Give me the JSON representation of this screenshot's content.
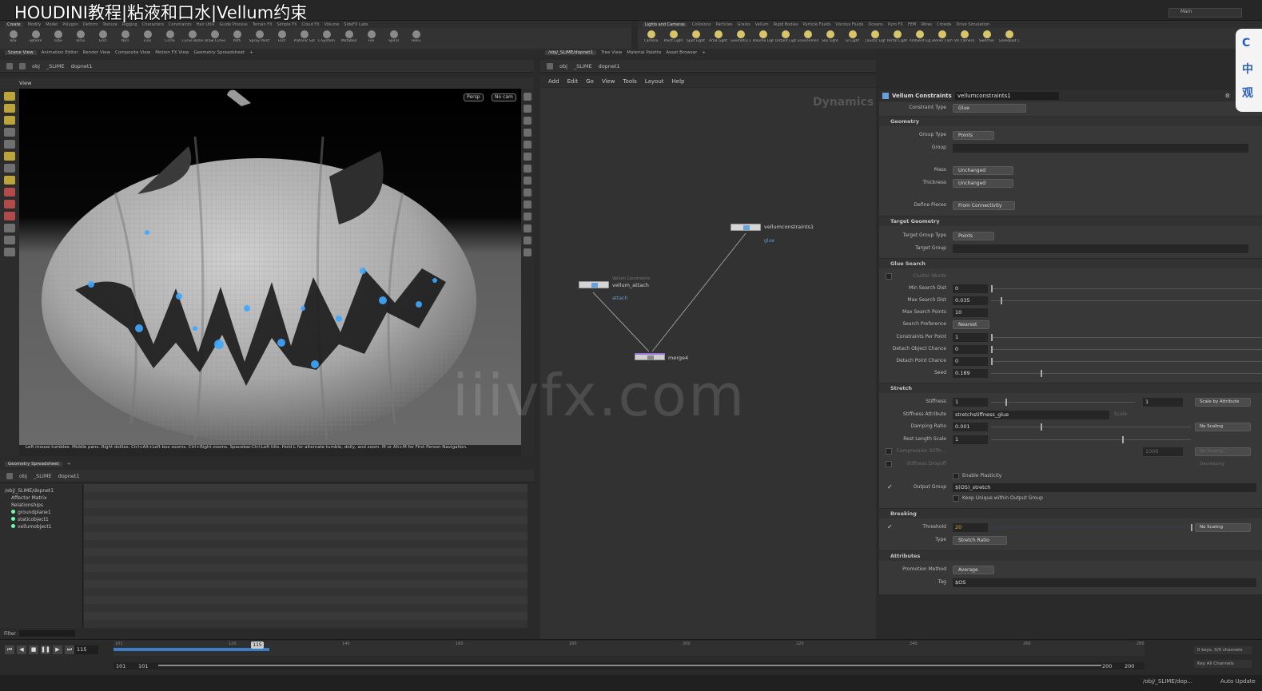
{
  "video_title": "HOUDINI教程|粘液和口水|Vellum约束",
  "watermark": "iiivfx.com",
  "corner_logo": [
    "C",
    "中",
    "观"
  ],
  "desktop": {
    "label": "Main"
  },
  "shelf_tabs_left": [
    "Create",
    "Modify",
    "Model",
    "Polygon",
    "Deform",
    "Texture",
    "Rigging",
    "Characters",
    "Constraints",
    "Hair Utils",
    "Guide Process",
    "Terrain FX",
    "Simple FX",
    "Cloud FX",
    "Volume",
    "SideFX Labs"
  ],
  "shelf_tabs_right": [
    "Lights and Cameras",
    "Collisions",
    "Particles",
    "Grains",
    "Vellum",
    "Rigid Bodies",
    "Particle Fluids",
    "Viscous Fluids",
    "Oceans",
    "Pyro FX",
    "FEM",
    "Wires",
    "Crowds",
    "Drive Simulation"
  ],
  "shelf_tools_left": [
    "Box",
    "Sphere",
    "Tube",
    "Torus",
    "Grid",
    "Null",
    "Line",
    "Circle",
    "Curve Bezier",
    "Draw Curve",
    "Path",
    "Spray Paint",
    "Font",
    "Platonic Solids",
    "L-System",
    "Metaball",
    "File",
    "Spiral",
    "Helix"
  ],
  "shelf_tools_right": [
    "Camera",
    "Point Light",
    "Spot Light",
    "Area Light",
    "Geometry Light",
    "Volume Light",
    "Distant Light",
    "Environment Light",
    "Sky Light",
    "GI Light",
    "Caustic Light",
    "Portal Light",
    "Ambient Light",
    "Stereo Camera",
    "VR Camera",
    "Switcher",
    "Gamepad Camera"
  ],
  "left_pane_tabs": [
    "Scene View",
    "Animation Editor",
    "Render View",
    "Composite View",
    "Motion FX View",
    "Geometry Spreadsheet"
  ],
  "right_pane_tabs": [
    "/obj/_SLIME/dopnet1",
    "Tree View",
    "Material Palette",
    "Asset Browser"
  ],
  "path": {
    "root": "obj",
    "object": "_SLIME",
    "node": "dopnet1"
  },
  "viewport": {
    "label": "View",
    "perspective": "Persp",
    "camera": "No cam",
    "hint": "Left mouse tumbles. Middle pans. Right dollies. Ctrl+Alt+Left box zooms. Ctrl+Right zooms. Spacebar-Ctrl-Left tilts. Hold L for alternate tumble, dolly, and zoom.    M or Alt+M for First Person Navigation."
  },
  "spreadsheet": {
    "tab": "Geometry Spreadsheet",
    "path_node": "dopnet1",
    "tree": [
      "/obj/_SLIME/dopnet1",
      "Affector Matrix",
      "Relationships",
      "groundplane1",
      "staticobject1",
      "vellumobject1"
    ],
    "filter_label": "Filter"
  },
  "network": {
    "menu": [
      "Add",
      "Edit",
      "Go",
      "View",
      "Tools",
      "Layout",
      "Help"
    ],
    "context": "Dynamics",
    "nodes": [
      {
        "name": "vellumconstraints1",
        "sub": "glue"
      },
      {
        "name": "vellum_attach",
        "type": "Vellum Constraints",
        "sub": "attach"
      },
      {
        "name": "merge4"
      }
    ]
  },
  "params": {
    "node_type": "Vellum Constraints",
    "node_name": "vellumconstraints1",
    "constraint_type": {
      "label": "Constraint Type",
      "value": "Glue"
    },
    "geometry": {
      "title": "Geometry",
      "group_type": {
        "label": "Group Type",
        "value": "Points"
      },
      "group": {
        "label": "Group",
        "value": ""
      },
      "mass": {
        "label": "Mass",
        "value": "Unchanged"
      },
      "thickness": {
        "label": "Thickness",
        "value": "Unchanged"
      },
      "define_pieces": {
        "label": "Define Pieces",
        "value": "From Connectivity"
      }
    },
    "target_geometry": {
      "title": "Target Geometry",
      "target_group_type": {
        "label": "Target Group Type",
        "value": "Points"
      },
      "target_group": {
        "label": "Target Group",
        "value": ""
      }
    },
    "glue_search": {
      "title": "Glue Search",
      "cluster_words": {
        "label": "Cluster Words"
      },
      "min_search_dist": {
        "label": "Min Search Dist",
        "value": "0"
      },
      "max_search_dist": {
        "label": "Max Search Dist",
        "value": "0.035"
      },
      "max_search_points": {
        "label": "Max Search Points",
        "value": "10"
      },
      "search_preference": {
        "label": "Search Preference",
        "value": "Nearest"
      },
      "constraints_per_point": {
        "label": "Constraints Per Point",
        "value": "1"
      },
      "detach_object_chance": {
        "label": "Detach Object Chance",
        "value": "0"
      },
      "detach_point_chance": {
        "label": "Detach Point Chance",
        "value": "0"
      },
      "seed": {
        "label": "Seed",
        "value": "0.189"
      }
    },
    "stretch": {
      "title": "Stretch",
      "stiffness": {
        "label": "Stiffness",
        "value": "1",
        "multiplier": "1",
        "scale": "Scale by Attribute"
      },
      "stiffness_attribute": {
        "label": "Stiffness Attribute",
        "value": "stretchstiffness_glue",
        "extra": "Scale"
      },
      "damping_ratio": {
        "label": "Damping Ratio",
        "value": "0.001",
        "scale": "No Scaling"
      },
      "rest_length_scale": {
        "label": "Rest Length Scale",
        "value": "1"
      },
      "compression_stiffness": {
        "label": "Compression Stiffn...",
        "value": "1000",
        "scale": "No Scaling"
      },
      "stiffness_dropoff": {
        "label": "Stiffness Dropoff",
        "scale": "Decreasing"
      },
      "enable_plasticity": {
        "label": "Enable Plasticity"
      },
      "output_group": {
        "label": "Output Group",
        "value": "$(OS)_stretch"
      },
      "keep_unique": {
        "label": "Keep Unique within Output Group"
      }
    },
    "breaking": {
      "title": "Breaking",
      "threshold": {
        "label": "Threshold",
        "value": "20",
        "scale": "No Scaling"
      },
      "type": {
        "label": "Type",
        "value": "Stretch Ratio"
      }
    },
    "attributes": {
      "title": "Attributes",
      "promotion_method": {
        "label": "Promotion Method",
        "value": "Average"
      },
      "tag": {
        "label": "Tag",
        "value": "$OS"
      }
    }
  },
  "timeline": {
    "current_frame": "115",
    "marker": "115",
    "start": "101",
    "start2": "101",
    "end": "200",
    "end2": "200",
    "ticks": [
      "101",
      "120",
      "140",
      "160",
      "180",
      "200",
      "220",
      "240",
      "260",
      "280"
    ],
    "keys_info": "0 keys, 0/0 channels",
    "key_all": "Key All Channels"
  },
  "status": {
    "path": "/obj/_SLIME/dop...",
    "auto_update": "Auto Update"
  }
}
